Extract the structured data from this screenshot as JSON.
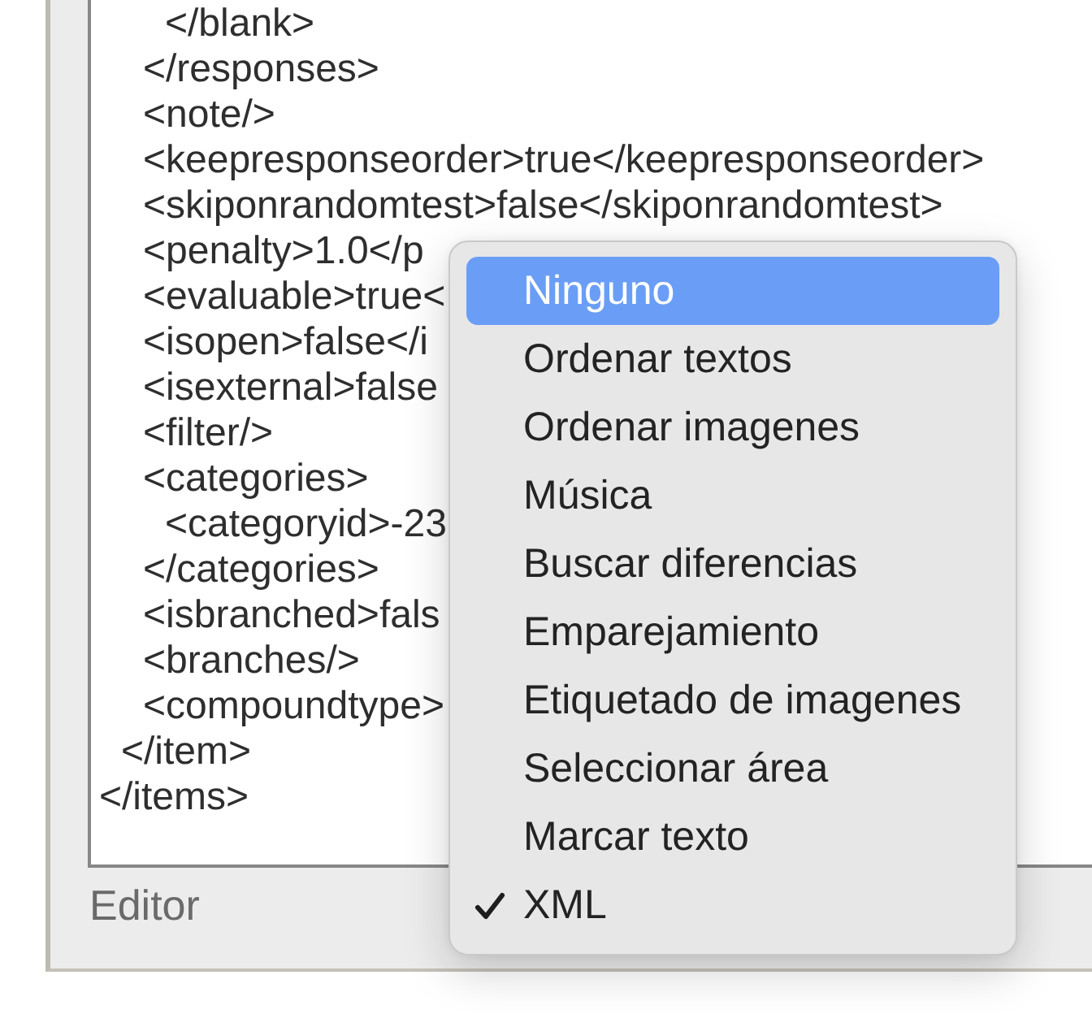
{
  "editor": {
    "lines": [
      {
        "children": [
          {
            "children": [
              {
                "children": [
                  {
                    "text": "</blank>"
                  }
                ]
              },
              {
                "text": "</responses>"
              },
              {
                "text": "<note/>"
              },
              {
                "text": "<keepresponseorder>true</keepresponseorder>"
              },
              {
                "text": "<skiponrandomtest>false</skiponrandomtest>"
              },
              {
                "text": "<penalty>1.0</p"
              },
              {
                "text": "<evaluable>true<"
              },
              {
                "text": "<isopen>false</i"
              },
              {
                "text": "<isexternal>false"
              },
              {
                "text": "<filter/>"
              },
              {
                "text": "<categories>",
                "children": [
                  {
                    "text": "<categoryid>-23"
                  }
                ]
              },
              {
                "text": "</categories>"
              },
              {
                "text": "<isbranched>fals"
              },
              {
                "text": "<branches/>"
              },
              {
                "text": "<compoundtype>"
              }
            ]
          },
          {
            "text": "</item>"
          }
        ]
      },
      {
        "text": "</items>"
      }
    ],
    "label": "Editor"
  },
  "menu": {
    "items": [
      {
        "label": "Ninguno",
        "highlighted": true,
        "checked": false
      },
      {
        "label": "Ordenar textos",
        "highlighted": false,
        "checked": false
      },
      {
        "label": "Ordenar imagenes",
        "highlighted": false,
        "checked": false
      },
      {
        "label": "Música",
        "highlighted": false,
        "checked": false
      },
      {
        "label": "Buscar diferencias",
        "highlighted": false,
        "checked": false
      },
      {
        "label": "Emparejamiento",
        "highlighted": false,
        "checked": false
      },
      {
        "label": "Etiquetado de imagenes",
        "highlighted": false,
        "checked": false
      },
      {
        "label": "Seleccionar área",
        "highlighted": false,
        "checked": false
      },
      {
        "label": "Marcar texto",
        "highlighted": false,
        "checked": false
      },
      {
        "label": "XML",
        "highlighted": false,
        "checked": true
      }
    ]
  }
}
